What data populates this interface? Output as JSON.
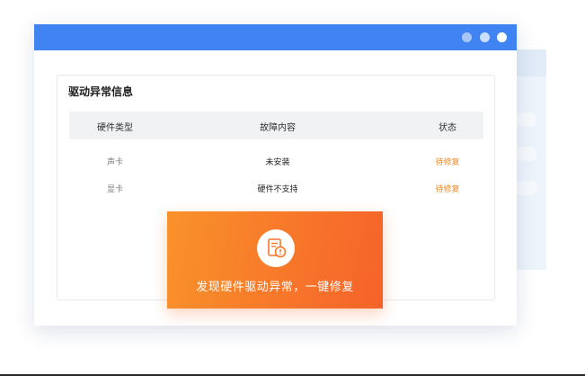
{
  "panel": {
    "title": "驱动异常信息",
    "columns": {
      "type": "硬件类型",
      "fault": "故障内容",
      "status": "状态"
    },
    "rows": [
      {
        "type": "声卡",
        "fault": "未安装",
        "status": "待修复"
      },
      {
        "type": "显卡",
        "fault": "硬件不支持",
        "status": "待修复"
      }
    ]
  },
  "toast": {
    "message": "发现硬件驱动异常，一键修复",
    "icon": "driver-alert-icon"
  },
  "colors": {
    "titlebar": "#3f84f2",
    "status_pending": "#f28a2a",
    "toast_start": "#f9922a",
    "toast_end": "#f6622a"
  }
}
